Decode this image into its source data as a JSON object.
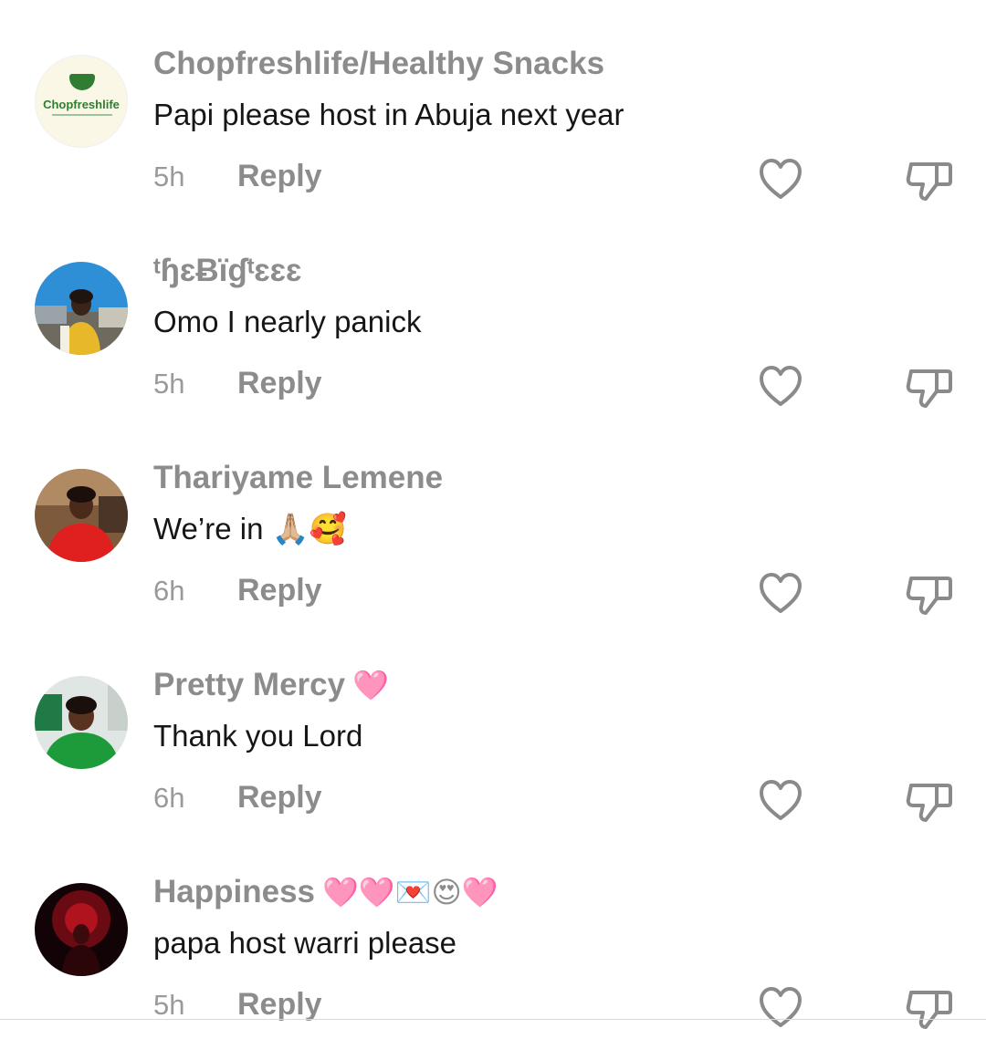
{
  "comments": [
    {
      "username": "Chopfreshlife/Healthy Snacks",
      "username_emoji": "",
      "avatar_text": "Chopfreshlife",
      "text": "Papi please host in Abuja next year",
      "time": "5h",
      "reply_label": "Reply"
    },
    {
      "username": "ᵗɧɛɃïɠᵗɛɛɛ",
      "username_emoji": "",
      "text": "Omo I nearly panick",
      "time": "5h",
      "reply_label": "Reply"
    },
    {
      "username": "Thariyame Lemene",
      "username_emoji": "",
      "text": "We’re in 🙏🏼🥰",
      "time": "6h",
      "reply_label": "Reply"
    },
    {
      "username": "Pretty Mercy",
      "username_emoji": "🩷",
      "text": "Thank you Lord",
      "time": "6h",
      "reply_label": "Reply"
    },
    {
      "username": "Happiness",
      "username_emoji": "🩷🩷💌😍🩷",
      "text": "papa host warri please",
      "time": "5h",
      "reply_label": "Reply"
    }
  ],
  "icons": {
    "like": "heart-outline-icon",
    "dislike": "thumbs-down-outline-icon"
  },
  "colors": {
    "username": "#8c8c8c",
    "text": "#161616",
    "meta": "#9a9a9a",
    "icon_stroke": "#8a8a8a"
  }
}
